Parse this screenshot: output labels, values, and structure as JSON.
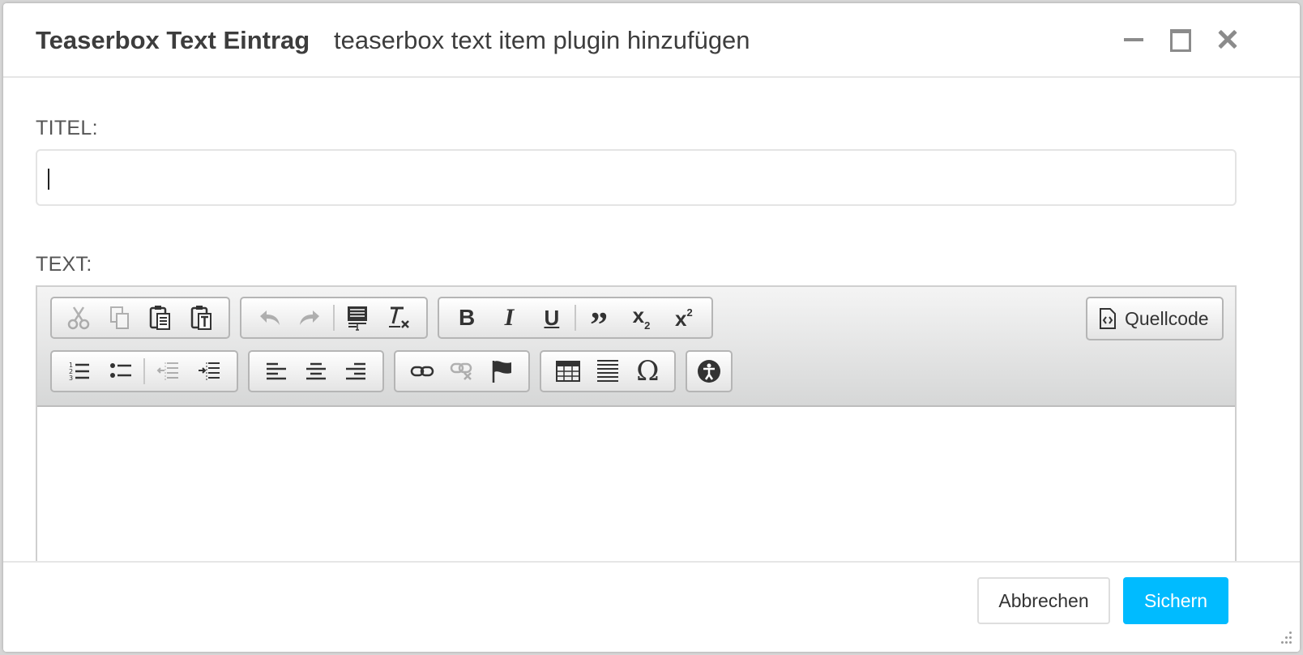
{
  "dialog": {
    "title": "Teaserbox Text Eintrag",
    "subtitle": "teaserbox text item plugin hinzufügen"
  },
  "form": {
    "title_label": "TITEL:",
    "title_value": "",
    "text_label": "TEXT:"
  },
  "editor": {
    "source_button_label": "Quellcode",
    "content": ""
  },
  "footer": {
    "cancel_label": "Abbrechen",
    "save_label": "Sichern"
  },
  "colors": {
    "primary": "#00bbff",
    "text": "#3d3d3d"
  },
  "icons": {
    "toolbar_row1": [
      "cut",
      "copy",
      "paste",
      "paste-as-text",
      "undo",
      "redo",
      "paste-from-word",
      "remove-format",
      "bold",
      "italic",
      "underline",
      "blockquote",
      "subscript",
      "superscript"
    ],
    "toolbar_row2": [
      "numbered-list",
      "bulleted-list",
      "outdent",
      "indent",
      "align-left",
      "align-center",
      "align-right",
      "link",
      "unlink",
      "anchor",
      "table",
      "horizontal-rule",
      "special-char",
      "accessibility"
    ]
  }
}
